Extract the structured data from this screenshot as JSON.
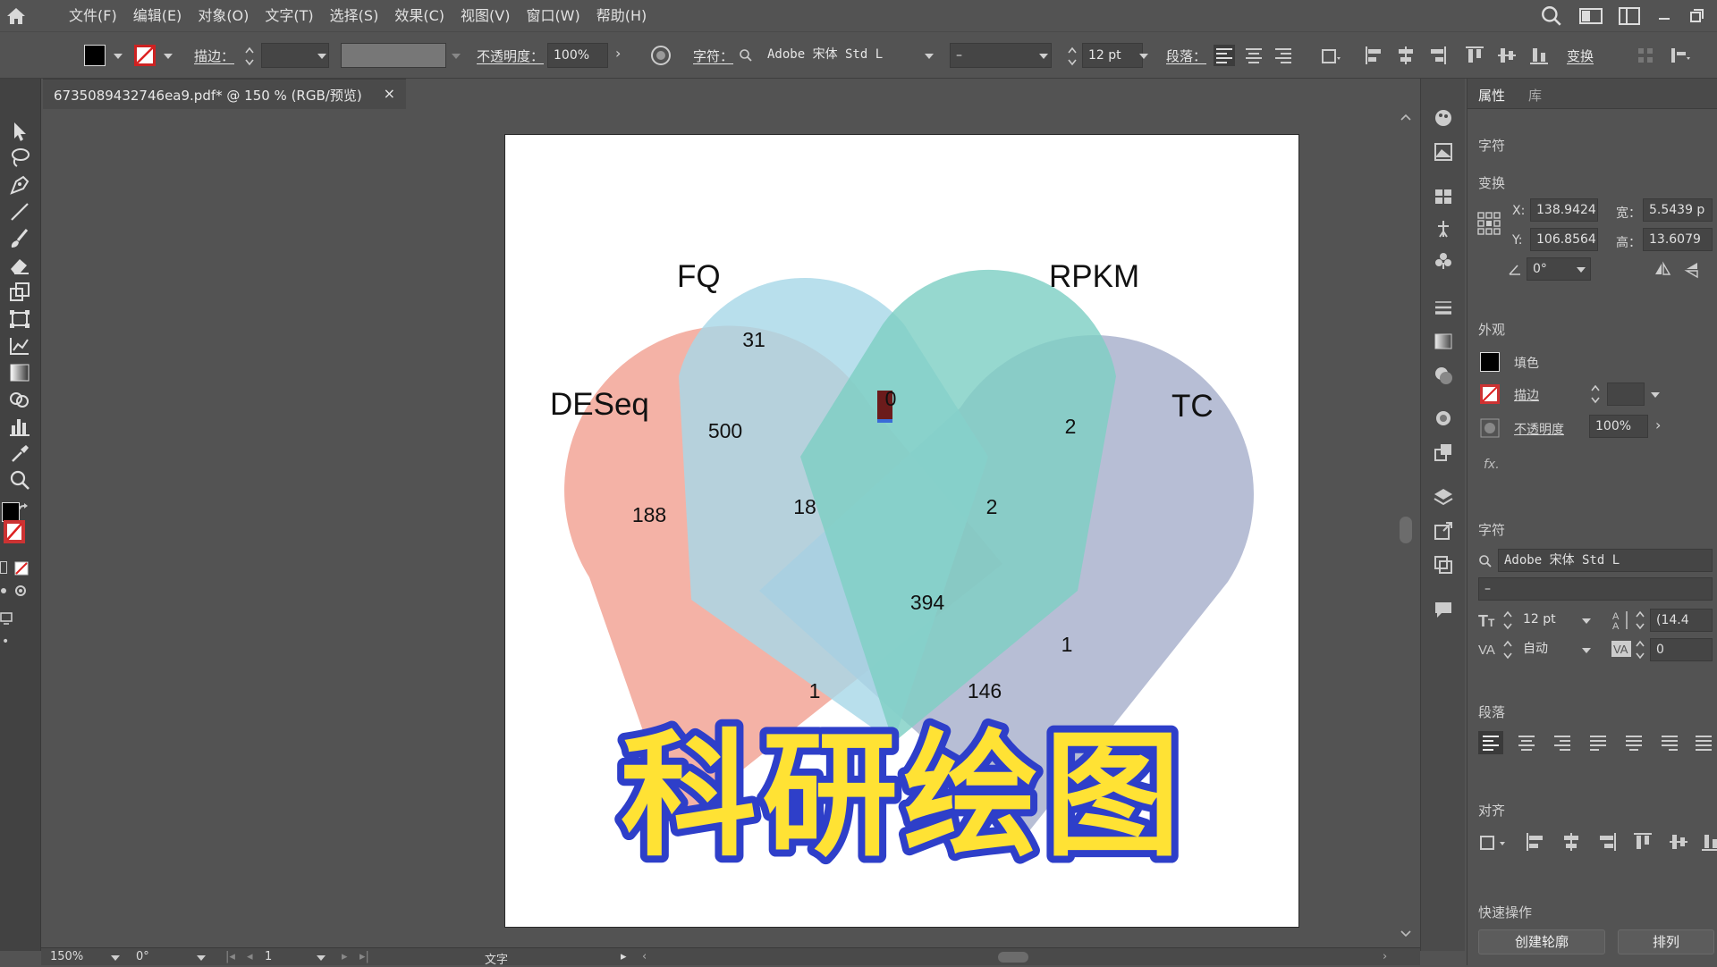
{
  "menubar": {
    "items": [
      "文件(F)",
      "编辑(E)",
      "对象(O)",
      "文字(T)",
      "选择(S)",
      "效果(C)",
      "视图(V)",
      "窗口(W)",
      "帮助(H)"
    ]
  },
  "controlbar": {
    "stroke_label": "描边：",
    "opacity_label": "不透明度：",
    "opacity_value": "100%",
    "char_label": "字符：",
    "font_family": "Adobe 宋体 Std L",
    "font_style": "–",
    "font_size": "12 pt",
    "para_label": "段落：",
    "transform_label": "变换"
  },
  "document": {
    "tab_title": "6735089432746ea9.pdf* @ 150 % (RGB/预览)",
    "close_glyph": "×"
  },
  "chart_data": {
    "type": "venn",
    "sets": [
      "FQ",
      "RPKM",
      "DESeq",
      "TC"
    ],
    "regions": [
      {
        "sets": [
          "FQ"
        ],
        "value": 31
      },
      {
        "sets": [
          "FQ",
          "RPKM"
        ],
        "value": 0
      },
      {
        "sets": [
          "RPKM",
          "TC"
        ],
        "value": 2
      },
      {
        "sets": [
          "DESeq",
          "FQ"
        ],
        "value": 500
      },
      {
        "sets": [
          "DESeq"
        ],
        "value": 188
      },
      {
        "sets": [
          "DESeq",
          "FQ",
          "RPKM"
        ],
        "value": 18
      },
      {
        "sets": [
          "FQ",
          "RPKM",
          "TC"
        ],
        "value": 2
      },
      {
        "sets": [
          "DESeq",
          "FQ",
          "RPKM",
          "TC"
        ],
        "value": 394
      },
      {
        "sets": [
          "RPKM",
          "TC",
          "DESeq"
        ],
        "value": 1
      },
      {
        "sets": [
          "DESeq",
          "FQ",
          "TC"
        ],
        "value": 1
      },
      {
        "sets": [
          "DESeq",
          "RPKM",
          "TC"
        ],
        "value": 146
      }
    ],
    "colors": {
      "FQ": "#a8d8e8",
      "RPKM": "#7fcfc4",
      "DESeq": "#f2a193",
      "TC": "#a7b0cc"
    }
  },
  "overlay": {
    "watermark": "科研绘图"
  },
  "props_panel": {
    "tab_properties": "属性",
    "tab_library": "库",
    "sec_character_top": "字符",
    "sec_transform": "变换",
    "x_label": "X:",
    "x_value": "138.9424",
    "y_label": "Y:",
    "y_value": "106.8564",
    "w_label": "宽：",
    "w_value": "5.5439 p",
    "h_label": "高：",
    "h_value": "13.6079",
    "angle_value": "0°",
    "sec_appearance": "外观",
    "fill_label": "填色",
    "stroke_label": "描边",
    "opacity_label": "不透明度",
    "opacity_value": "100%",
    "fx_label": "fx.",
    "sec_character": "字符",
    "font_family": "Adobe 宋体 Std L",
    "font_style": "–",
    "font_size": "12 pt",
    "leading": "(14.4",
    "kerning": "自动",
    "tracking": "0",
    "sec_paragraph": "段落",
    "sec_align": "对齐",
    "sec_quick_actions": "快速操作",
    "btn_outline": "创建轮廓",
    "btn_arrange": "排列"
  },
  "statusbar": {
    "zoom": "150%",
    "rotation": "0°",
    "page": "1",
    "tool_name": "文字"
  },
  "colors": {
    "ui_bg": "#535353",
    "panel_dark": "#424242",
    "selection_red": "#6b1b1b",
    "cursor_blue": "#2f3fd0"
  }
}
